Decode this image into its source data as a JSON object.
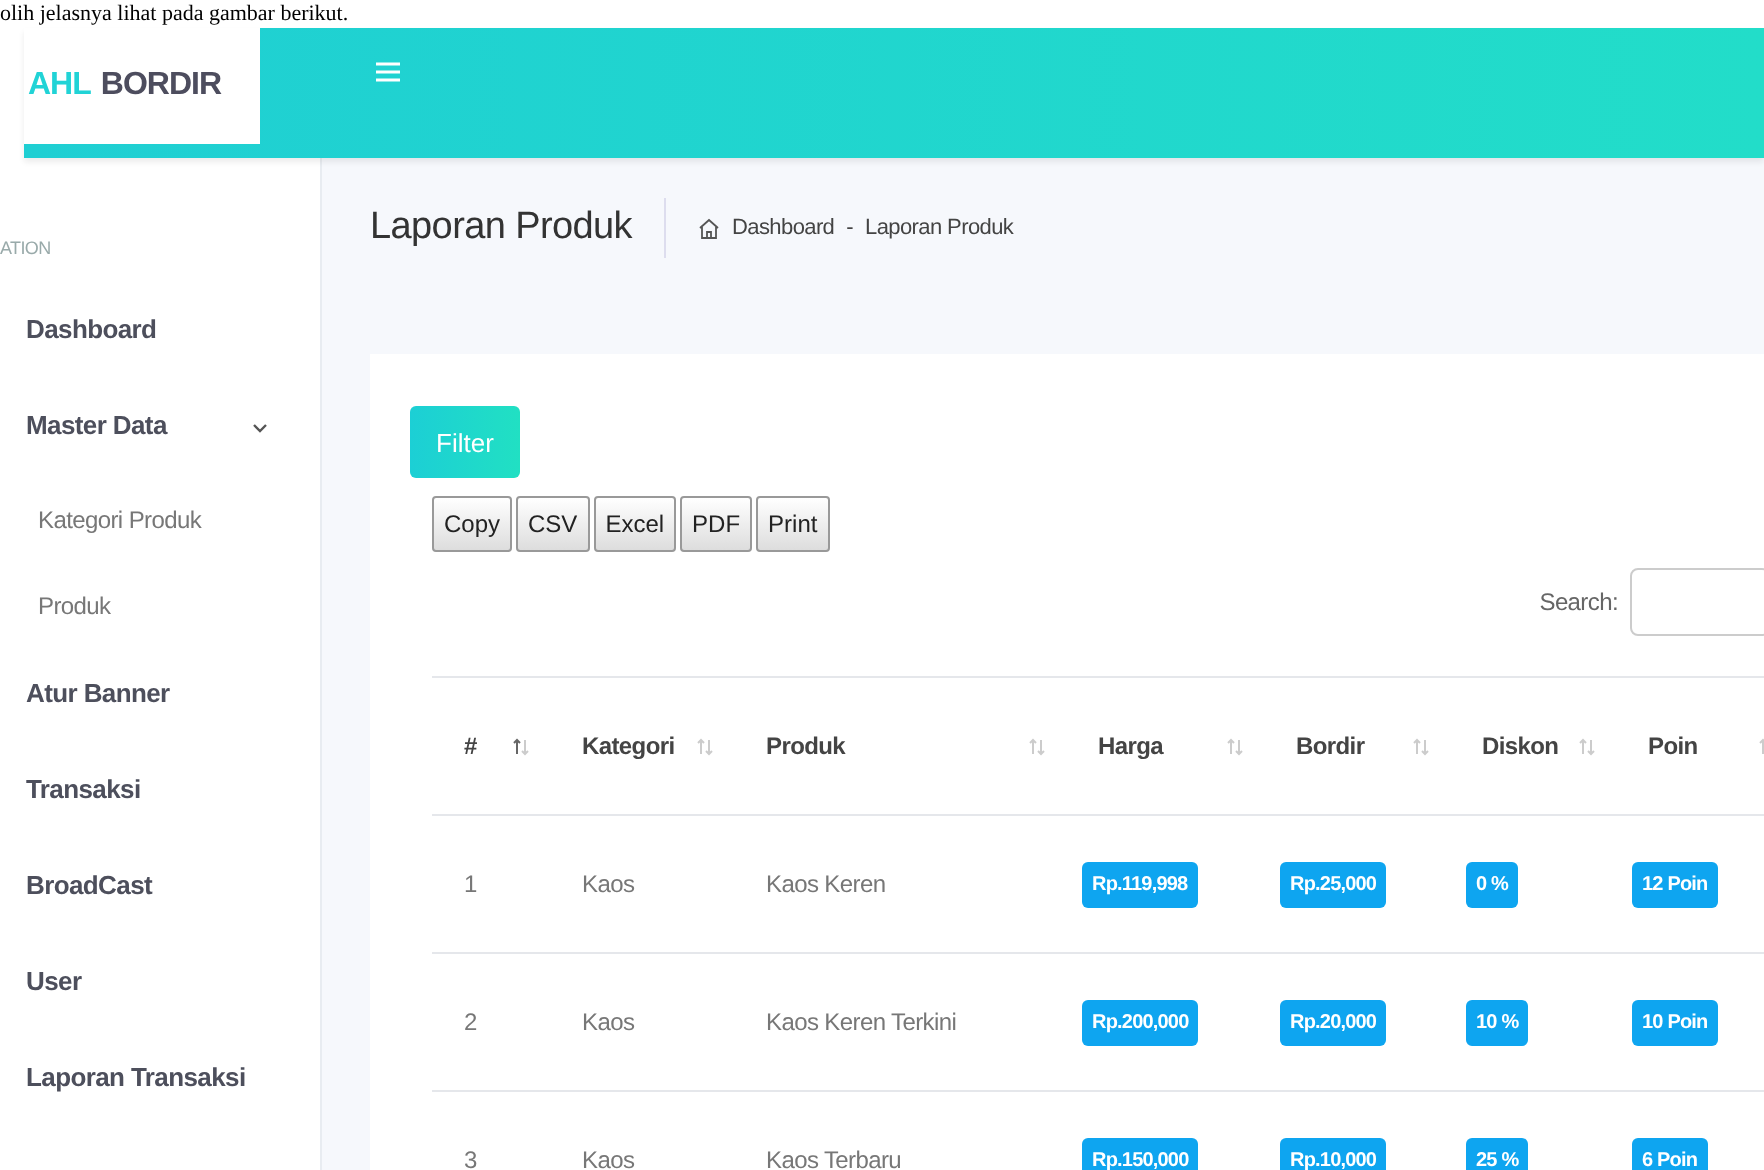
{
  "document_text": "olih jelasnya lihat pada gambar berikut.",
  "header": {
    "logo": {
      "accent": "AHL",
      "rest": "BORDIR"
    }
  },
  "sidebar": {
    "section_label": "ATION",
    "items": [
      {
        "label": "Dashboard",
        "kind": "item"
      },
      {
        "label": "Master Data",
        "kind": "group",
        "expanded": true,
        "children": [
          {
            "label": "Kategori Produk"
          },
          {
            "label": "Produk"
          }
        ]
      },
      {
        "label": "Atur Banner",
        "kind": "item"
      },
      {
        "label": "Transaksi",
        "kind": "item"
      },
      {
        "label": "BroadCast",
        "kind": "item"
      },
      {
        "label": "User",
        "kind": "item"
      },
      {
        "label": "Laporan Transaksi",
        "kind": "item"
      }
    ]
  },
  "page": {
    "title": "Laporan Produk",
    "breadcrumb": [
      "Dashboard",
      "-",
      "Laporan Produk"
    ]
  },
  "filter_button": "Filter",
  "export_buttons": [
    "Copy",
    "CSV",
    "Excel",
    "PDF",
    "Print"
  ],
  "search": {
    "label": "Search:"
  },
  "table": {
    "columns": [
      {
        "label": "#",
        "sorted": true
      },
      {
        "label": "Kategori",
        "sorted": false
      },
      {
        "label": "Produk",
        "sorted": false
      },
      {
        "label": "Harga",
        "sorted": false
      },
      {
        "label": "Bordir",
        "sorted": false
      },
      {
        "label": "Diskon",
        "sorted": false
      },
      {
        "label": "Poin",
        "sorted": false
      }
    ],
    "rows": [
      [
        "1",
        "Kaos",
        "Kaos Keren",
        "Rp.119,998",
        "Rp.25,000",
        "0 %",
        "12 Poin"
      ],
      [
        "2",
        "Kaos",
        "Kaos Keren Terkini",
        "Rp.200,000",
        "Rp.20,000",
        "10 %",
        "10 Poin"
      ],
      [
        "3",
        "Kaos",
        "Kaos Terbaru",
        "Rp.150,000",
        "Rp.10,000",
        "25 %",
        "6 Poin"
      ]
    ]
  }
}
